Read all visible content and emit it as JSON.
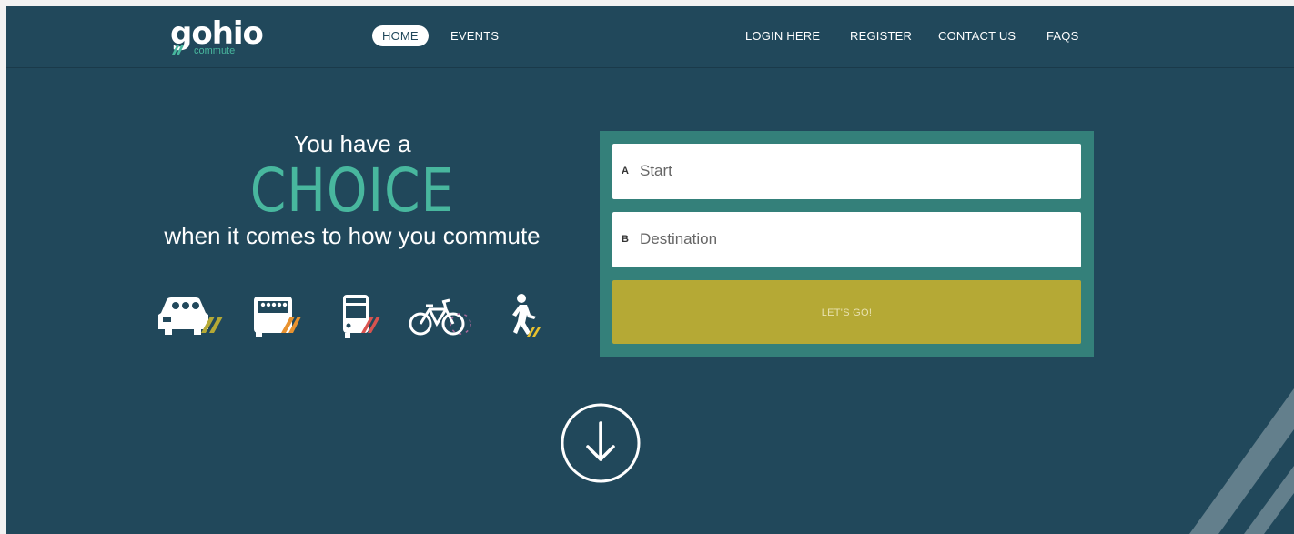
{
  "logo": {
    "main": "gohio",
    "sub": "commute"
  },
  "nav": {
    "home": "HOME",
    "events": "EVENTS",
    "login": "LOGIN HERE",
    "register": "REGISTER",
    "contact": "CONTACT US",
    "faqs": "FAQS"
  },
  "hero": {
    "line1": "You have a",
    "line2": "CHOICE",
    "line3": "when it comes to how you commute"
  },
  "modes": [
    "carpool-icon",
    "vanpool-icon",
    "bus-icon",
    "bike-icon",
    "walk-icon"
  ],
  "form": {
    "start_letter": "A",
    "start_placeholder": "Start",
    "destination_letter": "B",
    "destination_placeholder": "Destination",
    "submit_label": "LET'S GO!"
  },
  "colors": {
    "background": "#21485b",
    "accent_teal": "#48b79e",
    "form_bg": "#34807a",
    "button": "#b5a935"
  }
}
